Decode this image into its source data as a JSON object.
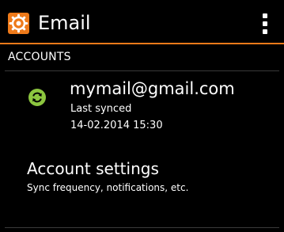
{
  "app": {
    "title": "Email",
    "icon": "settings-gear-icon",
    "accent_color": "#ee7a1a",
    "overflow_icon": "overflow-menu-icon"
  },
  "section": {
    "header": "ACCOUNTS"
  },
  "account": {
    "email": "mymail@gmail.com",
    "status": "Last synced",
    "last_synced": "14-02.2014 15:30",
    "icon": "sync-icon",
    "icon_color": "#8cc63f"
  },
  "settings": {
    "title": "Account settings",
    "subtitle": "Sync frequency, notifications, etc."
  }
}
